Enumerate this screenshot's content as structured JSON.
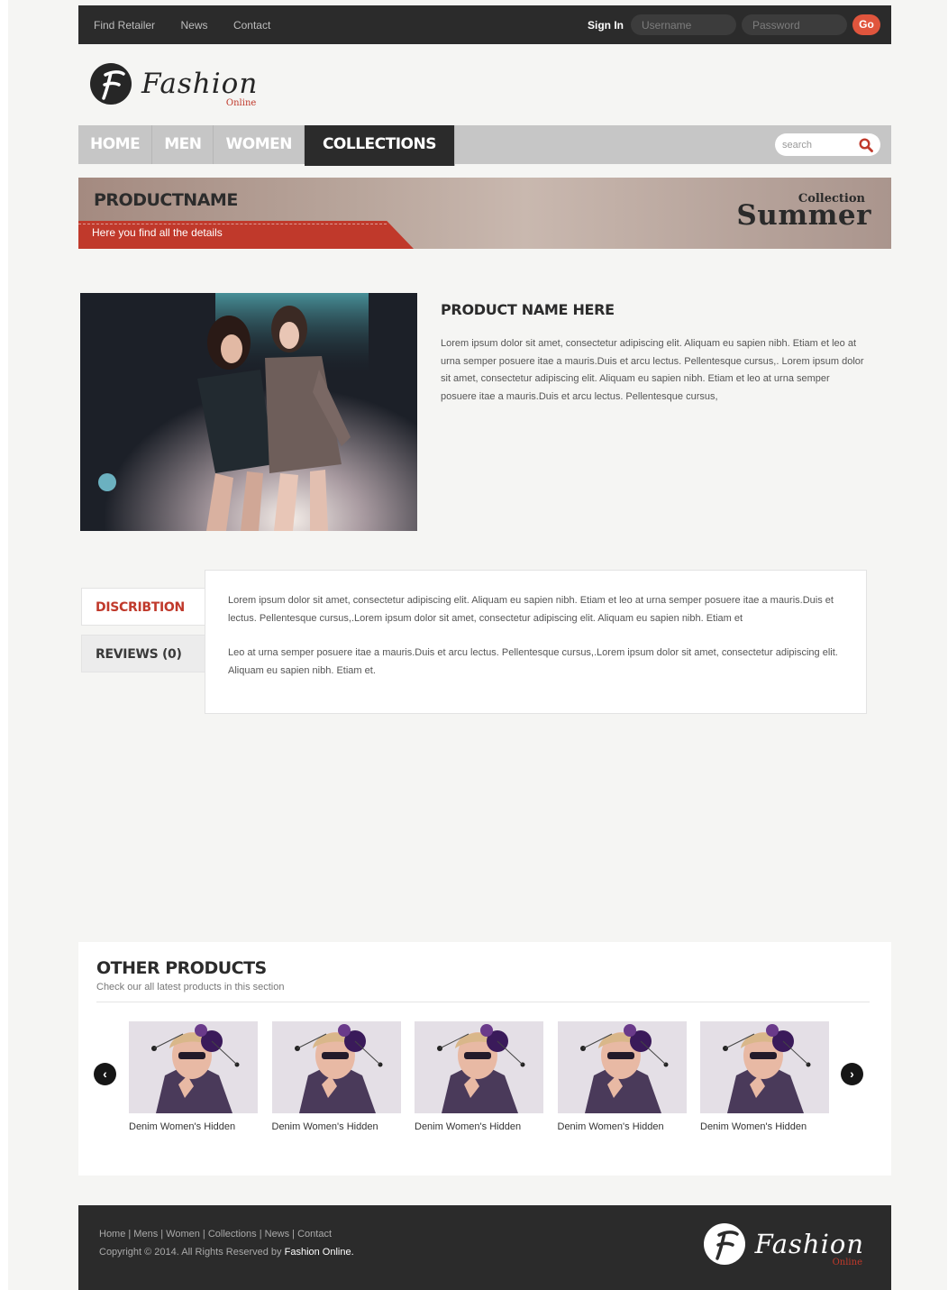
{
  "topbar": {
    "links": [
      "Find Retailer",
      "News",
      "Contact"
    ],
    "signin_label": "Sign In",
    "username_placeholder": "Username",
    "password_placeholder": "Password",
    "go_label": "Go"
  },
  "brand": {
    "name": "Fashion",
    "sub": "Online"
  },
  "nav": {
    "items": [
      "HOME",
      "MEN",
      "WOMEN",
      "COLLECTIONS"
    ],
    "active": "COLLECTIONS",
    "search_placeholder": "search"
  },
  "banner": {
    "product_name": "PRODUCTNAME",
    "tagline": "Here you find all the details",
    "collection_label": "Collection",
    "season": "Summer"
  },
  "product": {
    "title": "PRODUCT NAME HERE",
    "description": "Lorem ipsum dolor sit amet, consectetur adipiscing elit. Aliquam eu sapien nibh. Etiam et leo at urna semper posuere itae a mauris.Duis et arcu lectus. Pellentesque cursus,. Lorem ipsum dolor sit amet, consectetur adipiscing elit. Aliquam eu sapien nibh. Etiam et leo at urna semper posuere itae a mauris.Duis et arcu lectus. Pellentesque cursus,"
  },
  "tabs": {
    "items": [
      "DISCRIBTION",
      "REVIEWS (0)"
    ],
    "active": "DISCRIBTION",
    "content": [
      "Lorem ipsum dolor sit amet, consectetur adipiscing elit. Aliquam eu sapien nibh. Etiam et leo at urna semper posuere itae a mauris.Duis et lectus. Pellentesque cursus,.Lorem ipsum dolor sit amet, consectetur adipiscing elit. Aliquam eu sapien nibh. Etiam et",
      "Leo at urna semper posuere itae a mauris.Duis et arcu lectus. Pellentesque cursus,.Lorem ipsum dolor sit amet, consectetur adipiscing elit. Aliquam eu sapien nibh. Etiam et."
    ]
  },
  "other_products": {
    "title": "OTHER PRODUCTS",
    "subtitle": "Check our all latest products in this section",
    "items": [
      {
        "caption": "Denim Women's Hidden"
      },
      {
        "caption": "Denim Women's Hidden"
      },
      {
        "caption": "Denim Women's Hidden"
      },
      {
        "caption": "Denim Women's Hidden"
      },
      {
        "caption": "Denim Women's Hidden"
      }
    ]
  },
  "footer": {
    "links": "Home | Mens | Women | Collections | News | Contact",
    "copyright": "Copyright © 2014. All Rights Reserved by ",
    "copyright_brand": "Fashion Online."
  },
  "colors": {
    "accent": "#c0392b",
    "dark": "#2b2b2b",
    "go_button": "#e0553d",
    "nav_bg": "#c6c6c6"
  }
}
